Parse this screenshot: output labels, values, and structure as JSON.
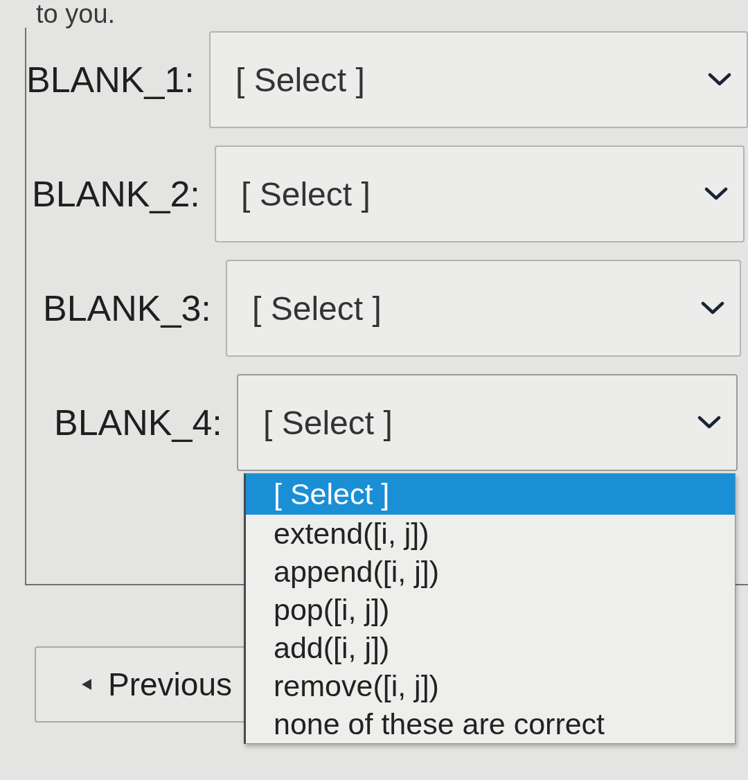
{
  "intro_text": "to you.",
  "blanks": [
    {
      "label": "BLANK_1:",
      "value": "[ Select ]",
      "expanded": false
    },
    {
      "label": "BLANK_2:",
      "value": "[ Select ]",
      "expanded": false
    },
    {
      "label": "BLANK_3:",
      "value": "[ Select ]",
      "expanded": false
    },
    {
      "label": "BLANK_4:",
      "value": "[ Select ]",
      "expanded": true,
      "options": [
        {
          "label": "[ Select ]",
          "selected": true
        },
        {
          "label": "extend([i, j])",
          "selected": false
        },
        {
          "label": "append([i, j])",
          "selected": false
        },
        {
          "label": "pop([i, j])",
          "selected": false
        },
        {
          "label": "add([i, j])",
          "selected": false
        },
        {
          "label": "remove([i, j])",
          "selected": false
        },
        {
          "label": "none of these are correct",
          "selected": false
        }
      ]
    }
  ],
  "previous_button": {
    "label": "Previous"
  }
}
